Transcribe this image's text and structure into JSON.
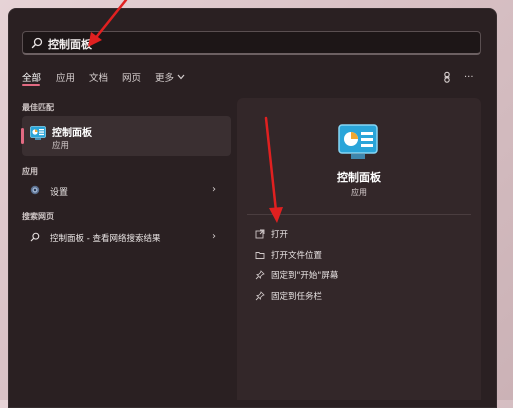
{
  "search": {
    "value": "控制面板"
  },
  "tabs": [
    {
      "label": "全部",
      "active": true
    },
    {
      "label": "应用"
    },
    {
      "label": "文档"
    },
    {
      "label": "网页"
    },
    {
      "label": "更多"
    }
  ],
  "top_icons": {
    "more": "···"
  },
  "sections": {
    "best_match": "最佳匹配",
    "apps": "应用",
    "web_search": "搜索网页"
  },
  "best_match_item": {
    "title": "控制面板",
    "subtitle": "应用"
  },
  "apps_items": [
    {
      "label": "设置"
    }
  ],
  "web_items": [
    {
      "label": "控制面板 - 查看网络搜索结果"
    }
  ],
  "right_panel": {
    "title": "控制面板",
    "subtitle": "应用",
    "actions": [
      {
        "label": "打开",
        "icon": "open-external-icon"
      },
      {
        "label": "打开文件位置",
        "icon": "folder-icon"
      },
      {
        "label": "固定到\"开始\"屏幕",
        "icon": "pin-icon"
      },
      {
        "label": "固定到任务栏",
        "icon": "pin-icon"
      }
    ]
  },
  "colors": {
    "accent": "#e26a82",
    "arrow": "#e02020",
    "panel": "#2a2022"
  }
}
